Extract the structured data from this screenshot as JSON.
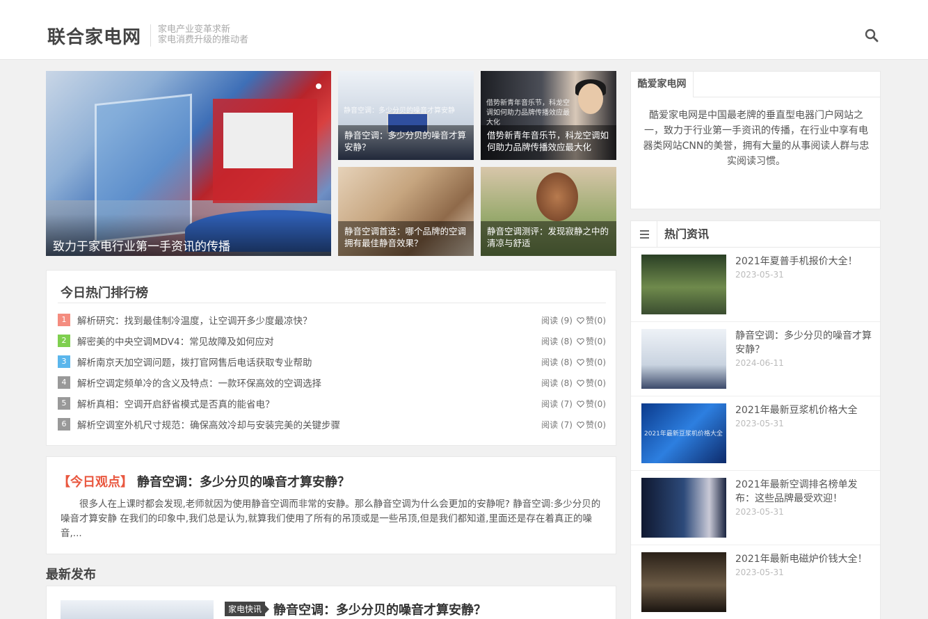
{
  "header": {
    "site_name": "联合家电网",
    "tagline_line1": "家电产业变革求新",
    "tagline_line2": "家电消费升级的推动者",
    "search_icon": "search-icon"
  },
  "carousel": {
    "main_caption": "致力于家电行业第一手资讯的传播",
    "tiles": [
      {
        "caption": "静音空调：多少分贝的噪音才算安静？",
        "image_text": "静音空调：多少分贝的噪音才算安静"
      },
      {
        "caption": "借势新青年音乐节，科龙空调如何助力品牌传播效应最大化",
        "image_text": "借势新青年音乐节，科龙空调如何助力品牌传播效应最大化"
      },
      {
        "caption": "静音空调首选：哪个品牌的空调拥有最佳静音效果？"
      },
      {
        "caption": "静音空调测评：发现寂静之中的清凉与舒适"
      }
    ]
  },
  "about": {
    "tab_label": "酷爱家电网",
    "text": "酷爱家电网是中国最老牌的垂直型电器门户网站之一，致力于行业第一手资讯的传播，在行业中享有电器类网站CNN的美誉，拥有大量的从事阅读人群与忠实阅读习惯。"
  },
  "hot_news": {
    "title": "热门资讯",
    "items": [
      {
        "title": "2021年夏普手机报价大全！",
        "date": "2023-05-31"
      },
      {
        "title": "静音空调：多少分贝的噪音才算安静？",
        "date": "2024-06-11"
      },
      {
        "title": "2021年最新豆浆机价格大全",
        "date": "2023-05-31",
        "image_text": "2021年最新豆浆机价格大全"
      },
      {
        "title": "2021年最新空调排名榜单发布：这些品牌最受欢迎！",
        "date": "2023-05-31"
      },
      {
        "title": "2021年最新电磁炉价钱大全！",
        "date": "2023-05-31"
      }
    ]
  },
  "ranking": {
    "title": "今日热门排行榜",
    "rows": [
      {
        "num": "1",
        "color": "#f48c7f",
        "title": "解析研究：找到最佳制冷温度，让空调开多少度最凉快？",
        "reads": "阅读 (9)",
        "likes": "赞(0)"
      },
      {
        "num": "2",
        "color": "#7fcf4f",
        "title": "解密美的中央空调MDV4：常见故障及如何应对",
        "reads": "阅读 (8)",
        "likes": "赞(0)"
      },
      {
        "num": "3",
        "color": "#5bb6ec",
        "title": "解析南京天加空调问题，拨打官网售后电话获取专业帮助",
        "reads": "阅读 (8)",
        "likes": "赞(0)"
      },
      {
        "num": "4",
        "color": "#999999",
        "title": "解析空调定频单冷的含义及特点：一款环保高效的空调选择",
        "reads": "阅读 (8)",
        "likes": "赞(0)"
      },
      {
        "num": "5",
        "color": "#999999",
        "title": "解析真相：空调开启舒省模式是否真的能省电？",
        "reads": "阅读 (7)",
        "likes": "赞(0)"
      },
      {
        "num": "6",
        "color": "#999999",
        "title": "解析空调室外机尺寸规范：确保高效冷却与安装完美的关键步骤",
        "reads": "阅读 (7)",
        "likes": "赞(0)"
      }
    ]
  },
  "viewpoint": {
    "tag": "【今日观点】",
    "title": "静音空调：多少分贝的噪音才算安静？",
    "body": "很多人在上课时都会发现,老师就因为使用静音空调而非常的安静。那么静音空调为什么会更加的安静呢? 静音空调:多少分贝的噪音才算安静 在我们的印象中,我们总是认为,就算我们使用了所有的吊顶或是一些吊顶,但是我们都知道,里面还是存在着真正的噪音,..."
  },
  "latest": {
    "section_title": "最新发布",
    "post": {
      "category": "家电快讯",
      "title": "静音空调：多少分贝的噪音才算安静？"
    }
  }
}
